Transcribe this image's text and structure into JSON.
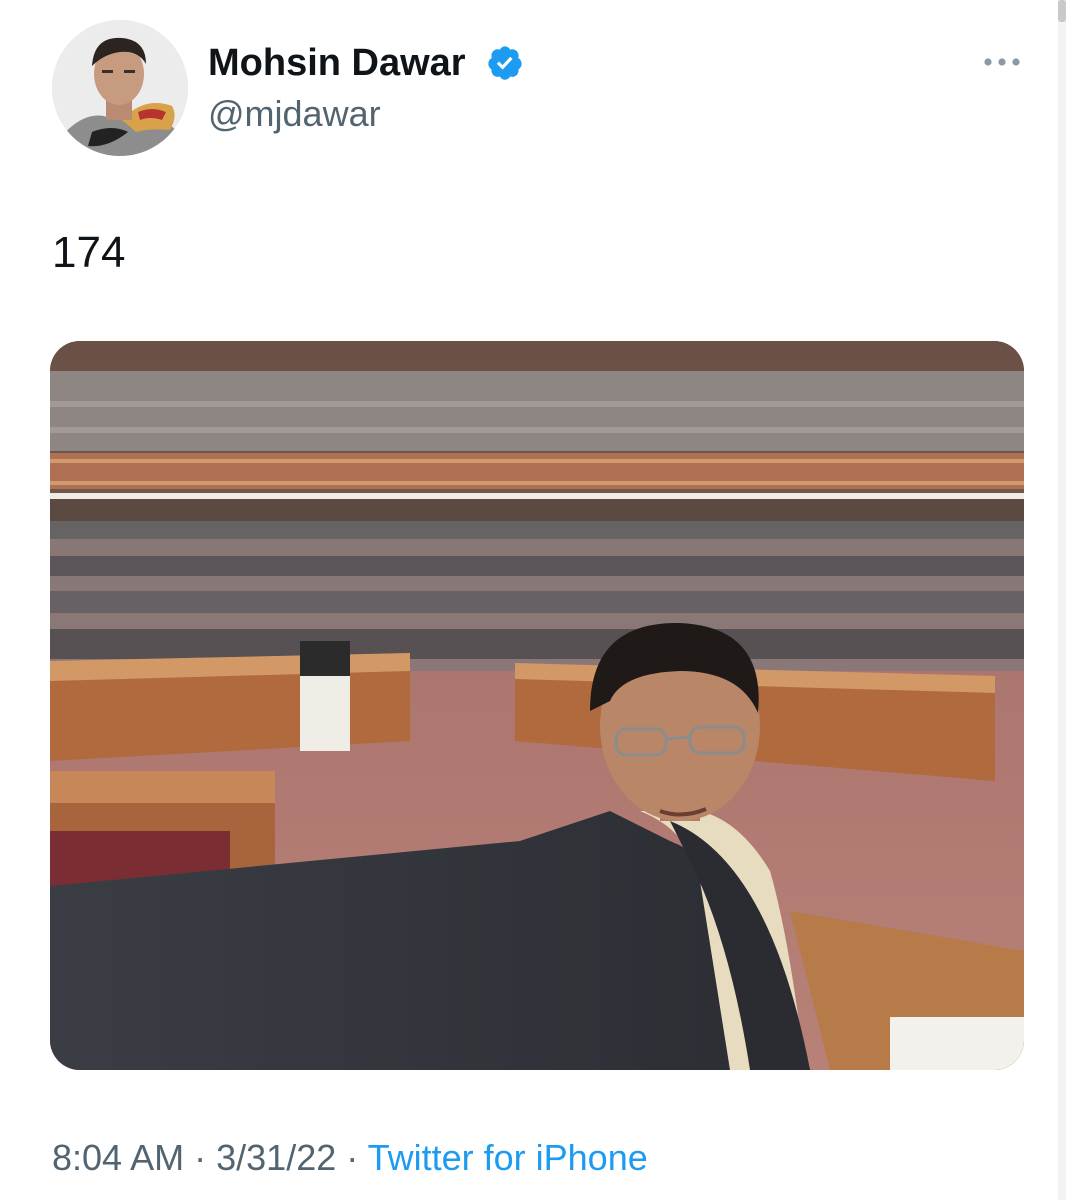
{
  "tweet": {
    "author": {
      "display_name": "Mohsin Dawar",
      "handle": "@mjdawar",
      "verified": true,
      "avatar_icon": "profile-photo",
      "verified_icon": "verified-badge-icon"
    },
    "text": "174",
    "media": {
      "kind": "photo"
    },
    "meta": {
      "time": "8:04 AM",
      "separator": "·",
      "date": "3/31/22",
      "source": "Twitter for iPhone"
    }
  },
  "colors": {
    "text_primary": "#0f1419",
    "text_secondary": "#536471",
    "link": "#1d9bf0",
    "verified": "#1d9bf0"
  }
}
